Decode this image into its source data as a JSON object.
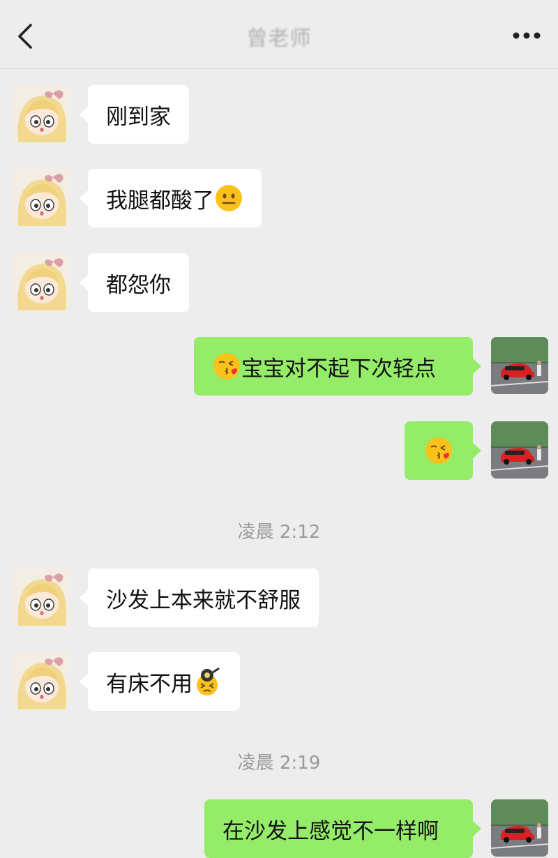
{
  "header": {
    "title": "曾老师",
    "back_icon": "chevron-left-icon",
    "more_icon": "more-dots-icon"
  },
  "messages": [
    {
      "side": "in",
      "text": "刚到家"
    },
    {
      "side": "in",
      "text": "我腿都酸了",
      "emoji": "neutral-face-emoji"
    },
    {
      "side": "in",
      "text": "都怨你"
    },
    {
      "side": "out",
      "text": "宝宝对不起下次轻点",
      "emoji": "kissing-face-emoji"
    },
    {
      "side": "out",
      "text": "",
      "emoji": "kissing-face-emoji"
    },
    {
      "type": "time",
      "text": "凌晨 2:12"
    },
    {
      "side": "in",
      "text": "沙发上本来就不舒服"
    },
    {
      "side": "in",
      "text": "有床不用",
      "emoji": "frustrated-pan-emoji"
    },
    {
      "type": "time",
      "text": "凌晨 2:19"
    },
    {
      "side": "out",
      "text": "在沙发上感觉不一样啊"
    }
  ],
  "avatars": {
    "contact": "anime-girl-avatar",
    "self": "red-car-avatar"
  }
}
